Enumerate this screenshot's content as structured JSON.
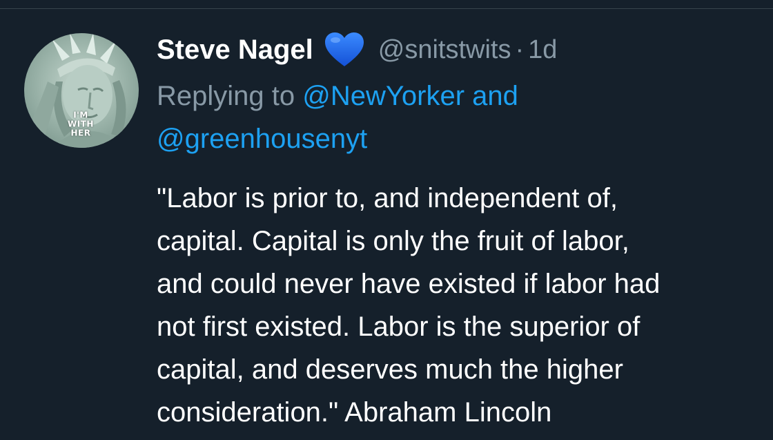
{
  "tweet": {
    "author": {
      "display_name": "Steve Nagel",
      "badge_icon": "blue-heart-icon",
      "handle": "@snitstwits",
      "avatar_badge_text": "I'M\nWITH\nHER"
    },
    "separator": "·",
    "time_ago": "1d",
    "reply": {
      "prefix": "Replying to",
      "mention_1": "@NewYorker",
      "conjunction": "and",
      "mention_2": "@greenhousenyt"
    },
    "text": "\"Labor is prior to, and independent of,\ncapital. Capital is only the fruit of labor,\nand could never have existed if labor had\nnot first existed. Labor is the superior of\ncapital, and deserves much the higher\nconsideration.\" Abraham  Lincoln"
  },
  "colors": {
    "background": "#15202b",
    "primary_text": "#ffffff",
    "secondary_text": "#8899a6",
    "link": "#1da1f2",
    "heart": "#1d6bf2"
  }
}
